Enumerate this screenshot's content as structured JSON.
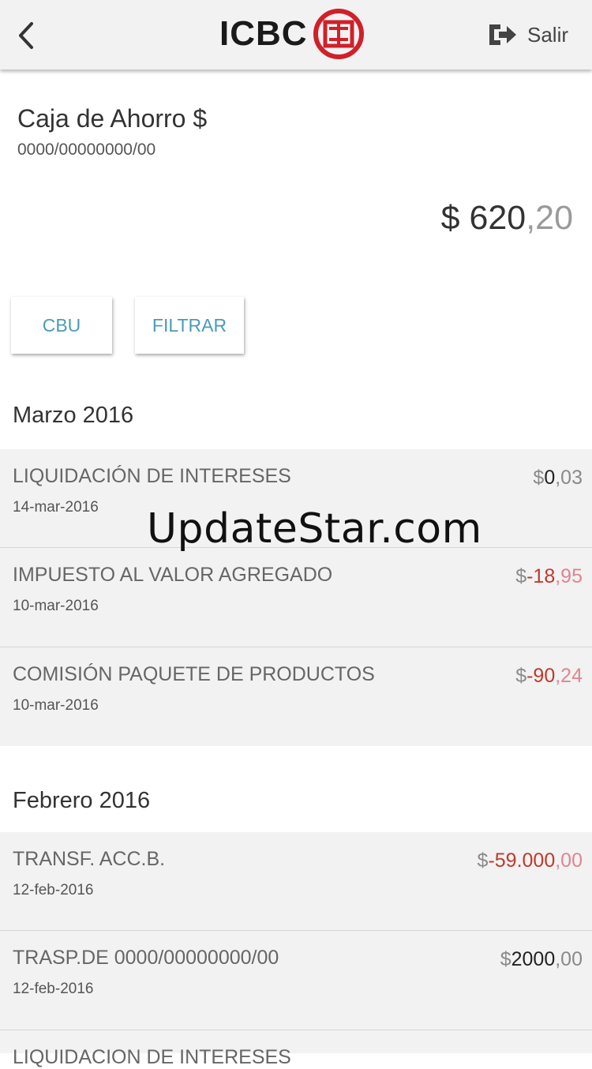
{
  "header": {
    "logo_text": "ICBC",
    "exit_label": "Salir"
  },
  "account": {
    "name": "Caja de Ahorro $",
    "number": "0000/00000000/00",
    "balance_currency": "$",
    "balance_int": "620",
    "balance_dec": ",20"
  },
  "actions": {
    "cbu_label": "CBU",
    "filter_label": "FILTRAR"
  },
  "months": [
    {
      "title": "Marzo 2016",
      "transactions": [
        {
          "description": "LIQUIDACIÓN DE INTERESES",
          "date": "14-mar-2016",
          "currency": "$",
          "int": "0",
          "dec": ",03"
        },
        {
          "description": "IMPUESTO AL VALOR AGREGADO",
          "date": "10-mar-2016",
          "currency": "$",
          "int": "-18",
          "dec": ",95"
        },
        {
          "description": "COMISIÓN PAQUETE DE PRODUCTOS",
          "date": "10-mar-2016",
          "currency": "$",
          "int": "-90",
          "dec": ",24"
        }
      ]
    },
    {
      "title": "Febrero 2016",
      "transactions": [
        {
          "description": "TRANSF. ACC.B.",
          "date": "12-feb-2016",
          "currency": "$",
          "int": "-59.000",
          "dec": ",00"
        },
        {
          "description": "TRASP.DE 0000/00000000/00",
          "date": "12-feb-2016",
          "currency": "$",
          "int": "2000",
          "dec": ",00"
        },
        {
          "description": "LIQUIDACION DE INTERESES",
          "date": "",
          "currency": "",
          "int": "",
          "dec": ""
        }
      ]
    }
  ],
  "watermark": "UpdateStar.com",
  "colors": {
    "header_bg": "#f2f2f2",
    "row_bg": "#f2f2f2",
    "accent": "#4b9bb8",
    "negative": "#c0392b",
    "negative_light": "#e08593",
    "logo_red": "#d0202a"
  }
}
